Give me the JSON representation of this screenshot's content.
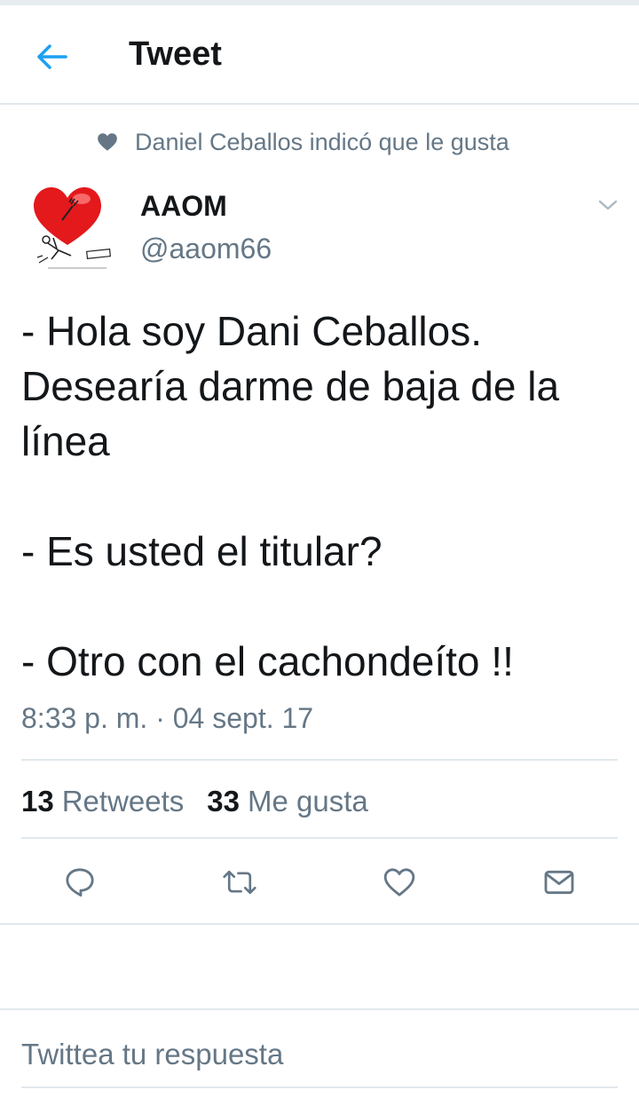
{
  "header": {
    "title": "Tweet",
    "back_icon": "arrow-left-icon",
    "accent_color": "#1da1f2"
  },
  "social_context": {
    "icon": "heart-filled-icon",
    "text": "Daniel Ceballos indicó que le gusta"
  },
  "author": {
    "name": "AAOM",
    "handle": "@aaom66",
    "avatar": "heart-cartoon-avatar"
  },
  "tweet": {
    "text": "- Hola soy Dani Ceballos. Desearía darme de baja de la línea\n\n- Es usted el titular?\n\n- Otro con el cachondeíto !!",
    "timestamp": "8:33 p. m. · 04 sept. 17"
  },
  "stats": {
    "retweets_count": "13",
    "retweets_label": "Retweets",
    "likes_count": "33",
    "likes_label": "Me gusta"
  },
  "actions": [
    "reply-icon",
    "retweet-icon",
    "like-icon",
    "message-icon"
  ],
  "reply_box": {
    "placeholder": "Twittea tu respuesta"
  },
  "colors": {
    "text_primary": "#14171a",
    "text_secondary": "#657786",
    "divider": "#e1e8ed"
  }
}
